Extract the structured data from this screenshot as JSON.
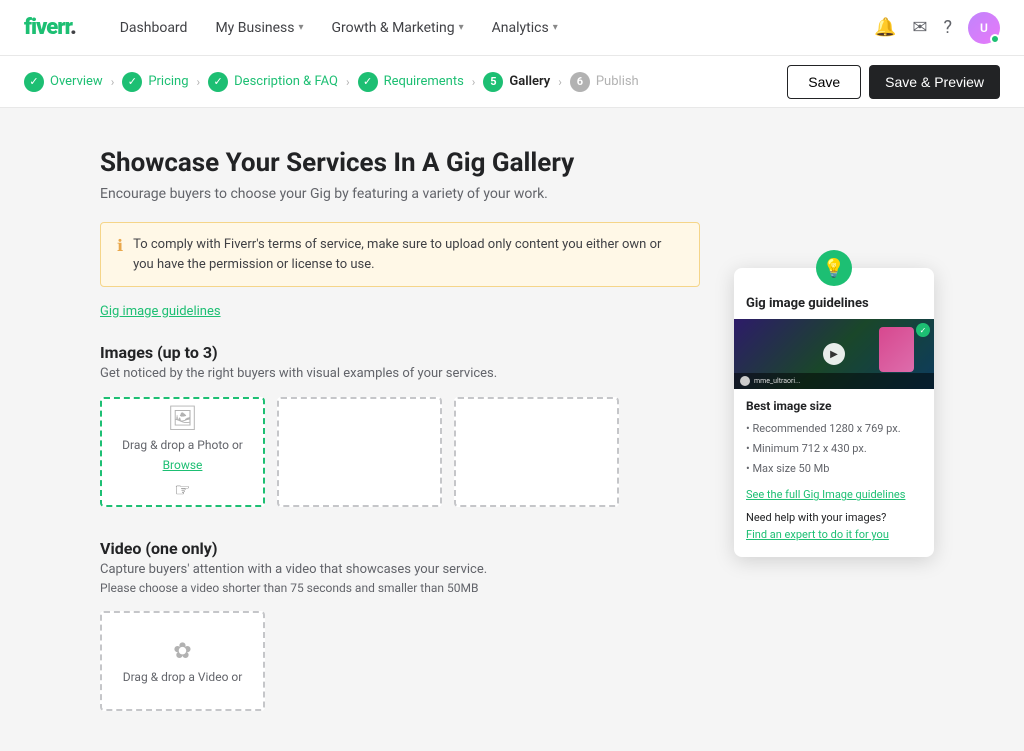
{
  "navbar": {
    "logo": "fiverr.",
    "links": [
      {
        "label": "Dashboard",
        "hasDropdown": false
      },
      {
        "label": "My Business",
        "hasDropdown": true
      },
      {
        "label": "Growth & Marketing",
        "hasDropdown": true
      },
      {
        "label": "Analytics",
        "hasDropdown": true
      }
    ],
    "save_label": "Save",
    "save_preview_label": "Save & Preview"
  },
  "steps": [
    {
      "label": "Overview",
      "status": "completed",
      "num": "1"
    },
    {
      "label": "Pricing",
      "status": "completed",
      "num": "2"
    },
    {
      "label": "Description & FAQ",
      "status": "completed",
      "num": "3"
    },
    {
      "label": "Requirements",
      "status": "completed",
      "num": "4"
    },
    {
      "label": "Gallery",
      "status": "active",
      "num": "5"
    },
    {
      "label": "Publish",
      "status": "inactive",
      "num": "6"
    }
  ],
  "page": {
    "title": "Showcase Your Services In A Gig Gallery",
    "subtitle": "Encourage buyers to choose your Gig by featuring a variety of your work.",
    "info_text": "To comply with Fiverr's terms of service, make sure to upload only content you either own or you have the permission or license to use.",
    "guidelines_link": "Gig image guidelines",
    "images_section": {
      "title": "Images (up to 3)",
      "subtitle": "Get noticed by the right buyers with visual examples of your services.",
      "upload_boxes": [
        {
          "label": "Drag & drop a Photo or",
          "browse": "Browse",
          "active": true
        },
        {
          "label": "",
          "browse": "",
          "active": false
        },
        {
          "label": "",
          "browse": "",
          "active": false
        }
      ]
    },
    "video_section": {
      "title": "Video (one only)",
      "subtitle": "Capture buyers' attention with a video that showcases your service.",
      "note": "Please choose a video shorter than 75 seconds and smaller than 50MB",
      "upload_label": "Drag & drop a Video or"
    }
  },
  "tooltip": {
    "title": "Gig image guidelines",
    "best_size_label": "Best image size",
    "size_items": [
      "Recommended 1280 x 769 px.",
      "Minimum 712 x 430 px.",
      "Max size 50 Mb"
    ],
    "full_guide_link": "See the full Gig Image guidelines",
    "help_text": "Need help with your images?",
    "expert_link": "Find an expert to do it for you",
    "thumb_user": "mme_ultraori..."
  }
}
